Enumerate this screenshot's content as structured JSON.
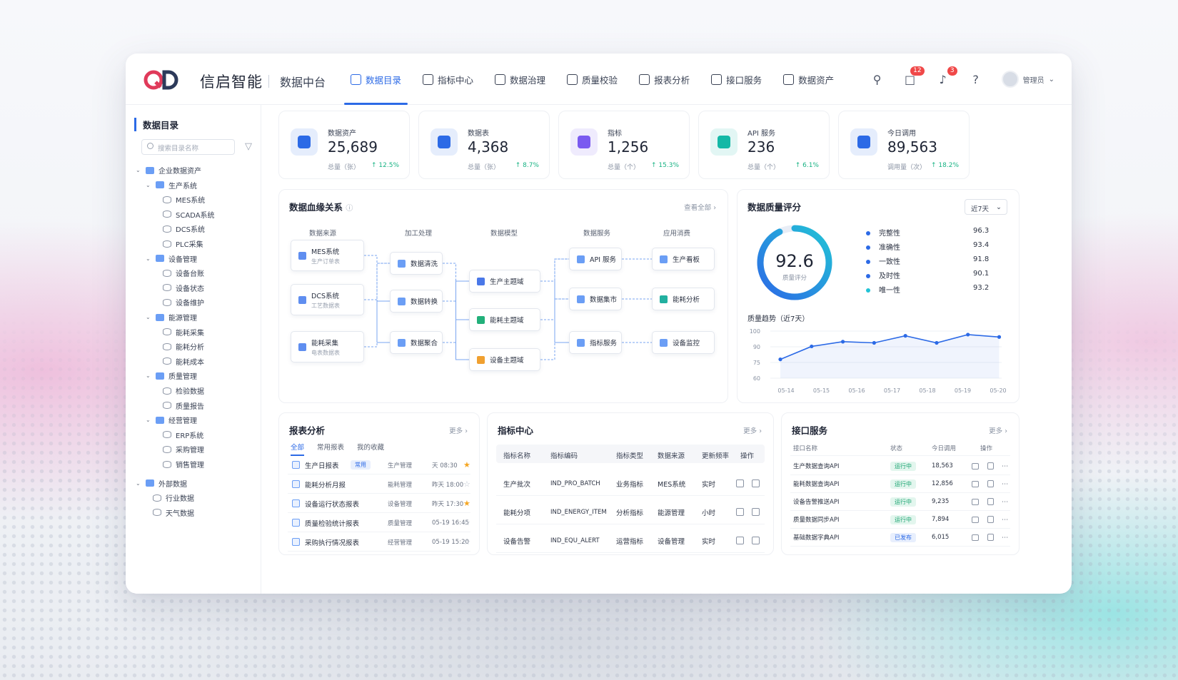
{
  "header": {
    "brand": "信启智能",
    "subtitle": "数据中台",
    "nav": [
      {
        "label": "数据目录"
      },
      {
        "label": "指标中心"
      },
      {
        "label": "数据治理"
      },
      {
        "label": "质量校验"
      },
      {
        "label": "报表分析"
      },
      {
        "label": "接口服务"
      },
      {
        "label": "数据资产"
      }
    ],
    "message_badge": "12",
    "notification_badge": "3",
    "user": "管理员"
  },
  "sidebar": {
    "title": "数据目录",
    "search_placeholder": "搜索目录名称",
    "tree": [
      {
        "label": "企业数据资产",
        "level": 0,
        "type": "folder"
      },
      {
        "label": "生产系统",
        "level": 1,
        "type": "folder"
      },
      {
        "label": "MES系统",
        "level": 2,
        "type": "db"
      },
      {
        "label": "SCADA系统",
        "level": 2,
        "type": "db"
      },
      {
        "label": "DCS系统",
        "level": 2,
        "type": "db"
      },
      {
        "label": "PLC采集",
        "level": 2,
        "type": "db"
      },
      {
        "label": "设备管理",
        "level": 1,
        "type": "folder"
      },
      {
        "label": "设备台账",
        "level": 2,
        "type": "db"
      },
      {
        "label": "设备状态",
        "level": 2,
        "type": "db"
      },
      {
        "label": "设备维护",
        "level": 2,
        "type": "db"
      },
      {
        "label": "能源管理",
        "level": 1,
        "type": "folder"
      },
      {
        "label": "能耗采集",
        "level": 2,
        "type": "db"
      },
      {
        "label": "能耗分析",
        "level": 2,
        "type": "db"
      },
      {
        "label": "能耗成本",
        "level": 2,
        "type": "db"
      },
      {
        "label": "质量管理",
        "level": 1,
        "type": "folder"
      },
      {
        "label": "检验数据",
        "level": 2,
        "type": "db"
      },
      {
        "label": "质量报告",
        "level": 2,
        "type": "db"
      },
      {
        "label": "经营管理",
        "level": 1,
        "type": "folder"
      },
      {
        "label": "ERP系统",
        "level": 2,
        "type": "db"
      },
      {
        "label": "采购管理",
        "level": 2,
        "type": "db"
      },
      {
        "label": "销售管理",
        "level": 2,
        "type": "db"
      },
      {
        "label": "外部数据",
        "level": 0,
        "type": "folder"
      },
      {
        "label": "行业数据",
        "level": 1,
        "type": "db"
      },
      {
        "label": "天气数据",
        "level": 1,
        "type": "db"
      }
    ]
  },
  "kpis": [
    {
      "label": "数据资产",
      "value": "25,689",
      "sub": "总量（张）",
      "delta": "↑ 12.5%",
      "color": "#2c6ae6",
      "icon": "database-icon"
    },
    {
      "label": "数据表",
      "value": "4,368",
      "sub": "总量（张）",
      "delta": "↑ 8.7%",
      "color": "#2c6ae6",
      "icon": "table-icon"
    },
    {
      "label": "指标",
      "value": "1,256",
      "sub": "总量（个）",
      "delta": "↑ 15.3%",
      "color": "#7a5af0",
      "icon": "bar-chart-icon"
    },
    {
      "label": "API 服务",
      "value": "236",
      "sub": "总量（个）",
      "delta": "↑ 6.1%",
      "color": "#14b8a6",
      "icon": "api-icon"
    },
    {
      "label": "今日调用",
      "value": "89,563",
      "sub": "调用量（次）",
      "delta": "↑ 18.2%",
      "color": "#2c6ae6",
      "icon": "pulse-icon"
    }
  ],
  "lineage": {
    "title": "数据血缘关系",
    "more": "查看全部",
    "columns": [
      "数据来源",
      "加工处理",
      "数据模型",
      "数据服务",
      "应用消费"
    ],
    "sources": [
      {
        "name": "MES系统",
        "desc": "生产订单表"
      },
      {
        "name": "DCS系统",
        "desc": "工艺数据表"
      },
      {
        "name": "能耗采集",
        "desc": "电表数据表"
      }
    ],
    "process": [
      "数据清洗",
      "数据转换",
      "数据聚合"
    ],
    "models": [
      "生产主题域",
      "能耗主题域",
      "设备主题域"
    ],
    "services": [
      "API 服务",
      "数据集市",
      "指标服务"
    ],
    "apps": [
      "生产看板",
      "能耗分析",
      "设备监控"
    ]
  },
  "quality": {
    "title": "数据质量评分",
    "range": "近7天",
    "score": "92.6",
    "score_label": "质量评分",
    "score_fraction": 0.926,
    "items": [
      {
        "name": "完整性",
        "value": "96.3",
        "color": "#2c6ae6"
      },
      {
        "name": "准确性",
        "value": "93.4",
        "color": "#2c6ae6"
      },
      {
        "name": "一致性",
        "value": "91.8",
        "color": "#2c6ae6"
      },
      {
        "name": "及时性",
        "value": "90.1",
        "color": "#2c6ae6"
      },
      {
        "name": "唯一性",
        "value": "93.2",
        "color": "#22c3d6"
      }
    ],
    "trend_title": "质量趋势（近7天）"
  },
  "chart_data": {
    "type": "line",
    "x": [
      "05-14",
      "05-15",
      "05-16",
      "05-17",
      "05-18",
      "05-19",
      "05-20"
    ],
    "yticks": [
      "100",
      "90",
      "75",
      "60"
    ],
    "series": [
      {
        "values": [
          76,
          87,
          91,
          90,
          96,
          90,
          97,
          95
        ]
      }
    ],
    "ylim": [
      60,
      100
    ]
  },
  "reports": {
    "title": "报表分析",
    "more": "更多",
    "tabs": [
      "全部",
      "常用报表",
      "我的收藏"
    ],
    "rows": [
      {
        "name": "生产日报表",
        "tag": "常用",
        "dept": "生产管理",
        "time": "天 08:30",
        "star": true
      },
      {
        "name": "能耗分析月报",
        "tag": "",
        "dept": "能耗管理",
        "time": "昨天 18:00",
        "star": false
      },
      {
        "name": "设备运行状态报表",
        "tag": "",
        "dept": "设备管理",
        "time": "昨天 17:30",
        "star": true
      },
      {
        "name": "质量检验统计报表",
        "tag": "",
        "dept": "质量管理",
        "time": "05-19 16:45",
        "star": false
      },
      {
        "name": "采购执行情况报表",
        "tag": "",
        "dept": "经营管理",
        "time": "05-19 15:20",
        "star": false
      }
    ]
  },
  "metrics": {
    "title": "指标中心",
    "more": "更多",
    "headers": [
      "指标名称",
      "指标编码",
      "指标类型",
      "数据来源",
      "更新频率",
      "操作"
    ],
    "rows": [
      {
        "name": "生产批次",
        "code": "IND_PRO_BATCH",
        "type": "业务指标",
        "source": "MES系统",
        "freq": "实时"
      },
      {
        "name": "能耗分项",
        "code": "IND_ENERGY_ITEM",
        "type": "分析指标",
        "source": "能源管理",
        "freq": "小时"
      },
      {
        "name": "设备告警",
        "code": "IND_EQU_ALERT",
        "type": "运营指标",
        "source": "设备管理",
        "freq": "实时"
      }
    ]
  },
  "apis": {
    "title": "接口服务",
    "more": "更多",
    "headers": [
      "接口名称",
      "状态",
      "今日调用",
      "操作"
    ],
    "rows": [
      {
        "name": "生产数据查询API",
        "status": "运行中",
        "calls": "18,563"
      },
      {
        "name": "能耗数据查询API",
        "status": "运行中",
        "calls": "12,856"
      },
      {
        "name": "设备告警推送API",
        "status": "运行中",
        "calls": "9,235"
      },
      {
        "name": "质量数据同步API",
        "status": "运行中",
        "calls": "7,894"
      },
      {
        "name": "基础数据字典API",
        "status": "已发布",
        "calls": "6,015"
      }
    ]
  }
}
